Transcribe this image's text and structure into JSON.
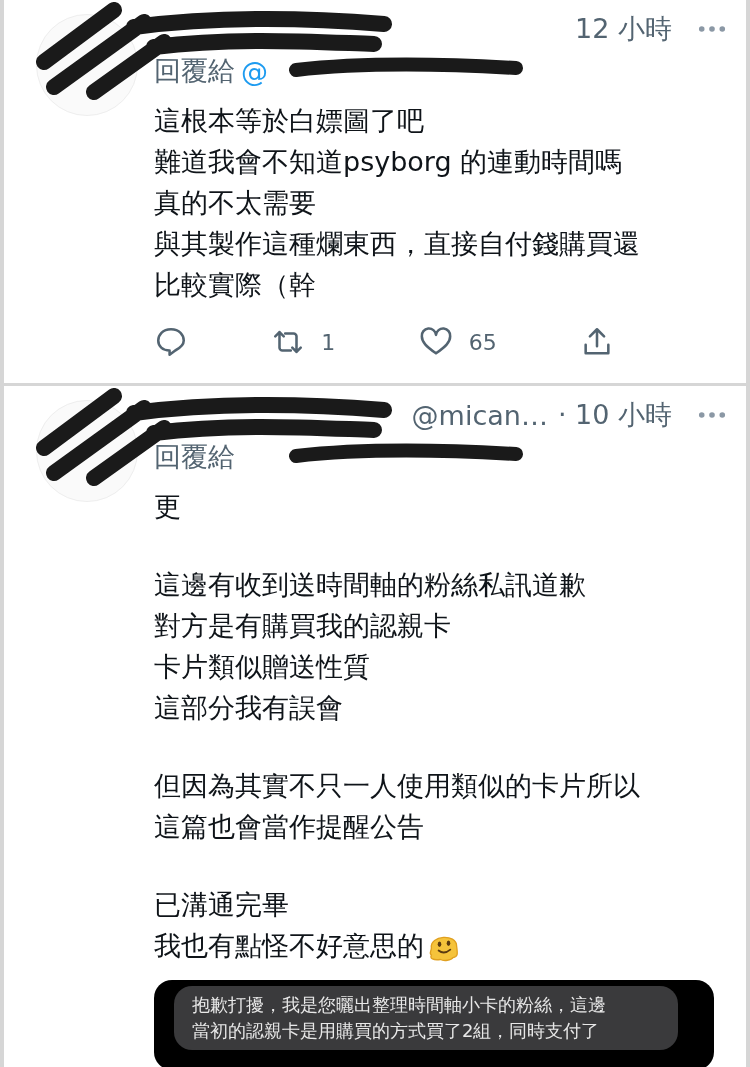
{
  "tweets": [
    {
      "time": "12 小時",
      "reply_to": "回覆給",
      "reply_handle": "@",
      "paragraphs": [
        [
          "這根本等於白嫖圖了吧",
          "難道我會不知道psyborg 的連動時間嗎",
          "真的不太需要",
          "與其製作這種爛東西，直接自付錢購買還",
          "比較實際（幹"
        ]
      ],
      "trailing_emoji": false,
      "actions": {
        "retweets": "1",
        "likes": "65"
      }
    },
    {
      "handle": "@mican…",
      "time": "· 10 小時",
      "reply_to": "回覆給",
      "paragraphs": [
        [
          "更"
        ],
        [
          "這邊有收到送時間軸的粉絲私訊道歉",
          "對方是有購買我的認親卡",
          "卡片類似贈送性質",
          "這部分我有誤會"
        ],
        [
          "但因為其實不只一人使用類似的卡片所以",
          "這篇也會當作提醒公告"
        ],
        [
          "已溝通完畢",
          "我也有點怪不好意思的"
        ]
      ],
      "trailing_emoji": true,
      "attachment": {
        "message_lines": [
          "抱歉打擾，我是您曬出整理時間軸小卡的粉絲，這邊",
          "當初的認親卡是用購買的方式買了2組，同時支付了"
        ]
      }
    }
  ]
}
